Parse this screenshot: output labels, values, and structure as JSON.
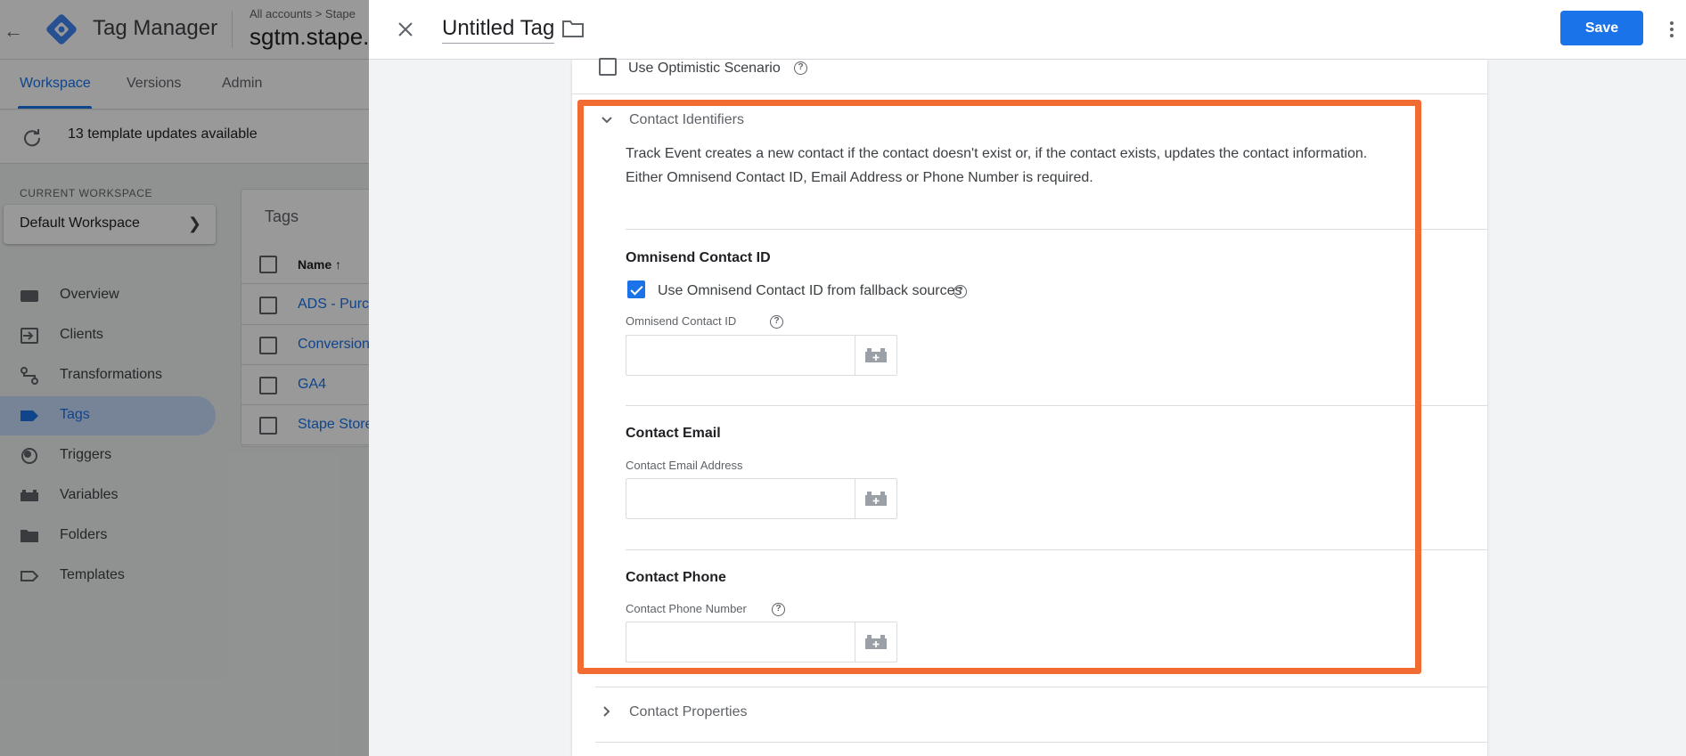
{
  "bg": {
    "app_title": "Tag Manager",
    "breadcrumb": "All accounts > Stape",
    "container_name": "sgtm.stape.",
    "tabs": [
      "Workspace",
      "Versions",
      "Admin"
    ],
    "updates_text": "13 template updates available",
    "current_workspace_label": "CURRENT WORKSPACE",
    "workspace_name": "Default Workspace",
    "nav": [
      {
        "label": "Overview",
        "icon": "overview-icon"
      },
      {
        "label": "Clients",
        "icon": "clients-icon"
      },
      {
        "label": "Transformations",
        "icon": "transformations-icon"
      },
      {
        "label": "Tags",
        "icon": "tag-icon",
        "active": true
      },
      {
        "label": "Triggers",
        "icon": "trigger-icon"
      },
      {
        "label": "Variables",
        "icon": "variables-icon"
      },
      {
        "label": "Folders",
        "icon": "folder-icon"
      },
      {
        "label": "Templates",
        "icon": "template-icon"
      }
    ],
    "tags_card": {
      "title": "Tags",
      "column_name": "Name ↑",
      "rows": [
        "ADS - Purch",
        "Conversion",
        "GA4",
        "Stape Store"
      ]
    }
  },
  "sheet": {
    "tag_name": "Untitled Tag",
    "save_label": "Save",
    "optimistic_label": "Use Optimistic Scenario",
    "contact_identifiers": {
      "title": "Contact Identifiers",
      "description_line1": "Track Event creates a new contact if the contact doesn't exist or, if the contact exists, updates the contact information.",
      "description_line2": "Either Omnisend Contact ID, Email Address or Phone Number is required.",
      "omnisend": {
        "title": "Omnisend Contact ID",
        "fallback_label": "Use Omnisend Contact ID from fallback sources",
        "fallback_checked": true,
        "field_label": "Omnisend Contact ID",
        "value": ""
      },
      "email": {
        "title": "Contact Email",
        "field_label": "Contact Email Address",
        "value": ""
      },
      "phone": {
        "title": "Contact Phone",
        "field_label": "Contact Phone Number",
        "value": ""
      }
    },
    "contact_properties_title": "Contact Properties"
  },
  "colors": {
    "accent": "#1a73e8",
    "highlight": "#f26b33",
    "active_nav": "#c6dafc"
  }
}
